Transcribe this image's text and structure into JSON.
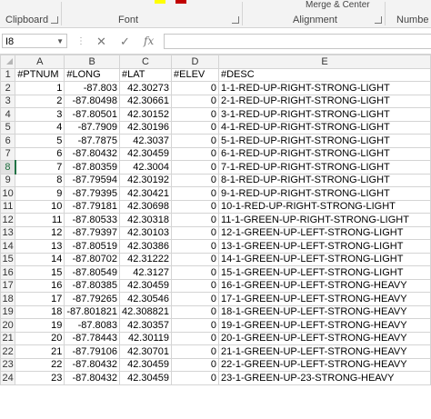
{
  "ribbon": {
    "groups": [
      {
        "label": "Clipboard"
      },
      {
        "label": "Font"
      },
      {
        "label": "Alignment"
      },
      {
        "label": "Numbe"
      }
    ],
    "merge_label": "Merge & Center"
  },
  "formula_bar": {
    "name_box": "I8",
    "cancel_glyph": "✕",
    "enter_glyph": "✓",
    "fx_label": "fx",
    "formula": ""
  },
  "columns": [
    "A",
    "B",
    "C",
    "D",
    "E"
  ],
  "selected_cell": {
    "column": "I",
    "row": 8
  },
  "rows": [
    {
      "n": "1",
      "cells": [
        "#PTNUM",
        "#LONG",
        "#LAT",
        "#ELEV",
        "#DESC"
      ]
    },
    {
      "n": "2",
      "cells": [
        "1",
        "-87.803",
        "42.30273",
        "0",
        "1-1-RED-UP-RIGHT-STRONG-LIGHT"
      ]
    },
    {
      "n": "3",
      "cells": [
        "2",
        "-87.80498",
        "42.30661",
        "0",
        "2-1-RED-UP-RIGHT-STRONG-LIGHT"
      ]
    },
    {
      "n": "4",
      "cells": [
        "3",
        "-87.80501",
        "42.30152",
        "0",
        "3-1-RED-UP-RIGHT-STRONG-LIGHT"
      ]
    },
    {
      "n": "5",
      "cells": [
        "4",
        "-87.7909",
        "42.30196",
        "0",
        "4-1-RED-UP-RIGHT-STRONG-LIGHT"
      ]
    },
    {
      "n": "6",
      "cells": [
        "5",
        "-87.7875",
        "42.3037",
        "0",
        "5-1-RED-UP-RIGHT-STRONG-LIGHT"
      ]
    },
    {
      "n": "7",
      "cells": [
        "6",
        "-87.80432",
        "42.30459",
        "0",
        "6-1-RED-UP-RIGHT-STRONG-LIGHT"
      ]
    },
    {
      "n": "8",
      "cells": [
        "7",
        "-87.80359",
        "42.3004",
        "0",
        "7-1-RED-UP-RIGHT-STRONG-LIGHT"
      ]
    },
    {
      "n": "9",
      "cells": [
        "8",
        "-87.79594",
        "42.30192",
        "0",
        "8-1-RED-UP-RIGHT-STRONG-LIGHT"
      ]
    },
    {
      "n": "10",
      "cells": [
        "9",
        "-87.79395",
        "42.30421",
        "0",
        "9-1-RED-UP-RIGHT-STRONG-LIGHT"
      ]
    },
    {
      "n": "11",
      "cells": [
        "10",
        "-87.79181",
        "42.30698",
        "0",
        "10-1-RED-UP-RIGHT-STRONG-LIGHT"
      ]
    },
    {
      "n": "12",
      "cells": [
        "11",
        "-87.80533",
        "42.30318",
        "0",
        "11-1-GREEN-UP-RIGHT-STRONG-LIGHT"
      ]
    },
    {
      "n": "13",
      "cells": [
        "12",
        "-87.79397",
        "42.30103",
        "0",
        "12-1-GREEN-UP-LEFT-STRONG-LIGHT"
      ]
    },
    {
      "n": "14",
      "cells": [
        "13",
        "-87.80519",
        "42.30386",
        "0",
        "13-1-GREEN-UP-LEFT-STRONG-LIGHT"
      ]
    },
    {
      "n": "15",
      "cells": [
        "14",
        "-87.80702",
        "42.31222",
        "0",
        "14-1-GREEN-UP-LEFT-STRONG-LIGHT"
      ]
    },
    {
      "n": "16",
      "cells": [
        "15",
        "-87.80549",
        "42.3127",
        "0",
        "15-1-GREEN-UP-LEFT-STRONG-LIGHT"
      ]
    },
    {
      "n": "17",
      "cells": [
        "16",
        "-87.80385",
        "42.30459",
        "0",
        "16-1-GREEN-UP-LEFT-STRONG-HEAVY"
      ]
    },
    {
      "n": "18",
      "cells": [
        "17",
        "-87.79265",
        "42.30546",
        "0",
        "17-1-GREEN-UP-LEFT-STRONG-HEAVY"
      ]
    },
    {
      "n": "19",
      "cells": [
        "18",
        "-87.801821",
        "42.308821",
        "0",
        "18-1-GREEN-UP-LEFT-STRONG-HEAVY"
      ]
    },
    {
      "n": "20",
      "cells": [
        "19",
        "-87.8083",
        "42.30357",
        "0",
        "19-1-GREEN-UP-LEFT-STRONG-HEAVY"
      ]
    },
    {
      "n": "21",
      "cells": [
        "20",
        "-87.78443",
        "42.30119",
        "0",
        "20-1-GREEN-UP-LEFT-STRONG-HEAVY"
      ]
    },
    {
      "n": "22",
      "cells": [
        "21",
        "-87.79106",
        "42.30701",
        "0",
        "21-1-GREEN-UP-LEFT-STRONG-HEAVY"
      ]
    },
    {
      "n": "23",
      "cells": [
        "22",
        "-87.80432",
        "42.30459",
        "0",
        "22-1-GREEN-UP-LEFT-STRONG-HEAVY"
      ]
    },
    {
      "n": "24",
      "cells": [
        "23",
        "-87.80432",
        "42.30459",
        "0",
        "23-1-GREEN-UP-23-STRONG-HEAVY"
      ]
    }
  ],
  "colors": {
    "selection_accent": "#217346",
    "font_color_swatch": "#c00000",
    "highlight_swatch": "#ffff00"
  }
}
